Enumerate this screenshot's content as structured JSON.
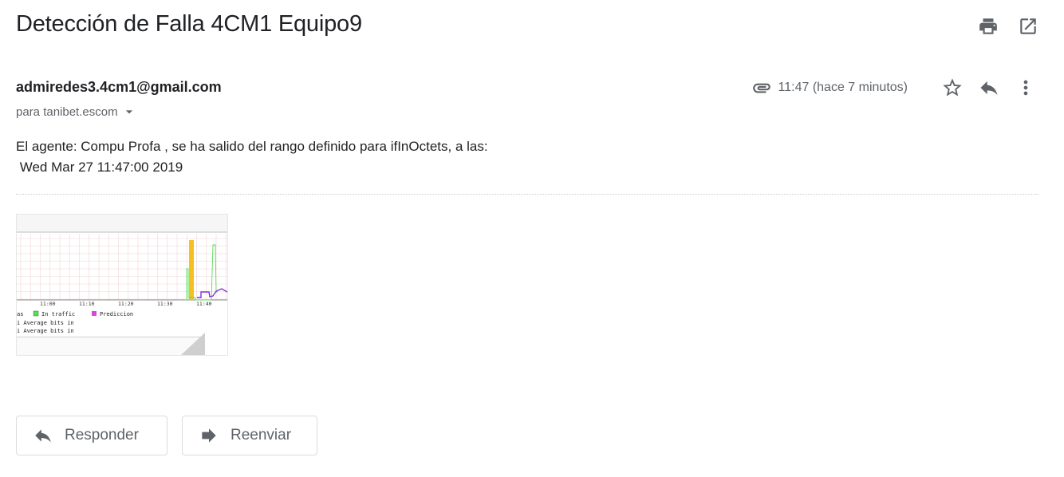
{
  "email": {
    "subject": "Detección de Falla 4CM1 Equipo9",
    "sender": "admiredes3.4cm1@gmail.com",
    "recipient": "para tanibet.escom",
    "time": "11:47 (hace 7 minutos)",
    "body_line1": "El agente: Compu Profa , se ha salido del rango definido para ifInOctets, a las:",
    "body_line2": " Wed Mar 27 11:47:00 2019"
  },
  "attachment": {
    "x_ticks": [
      "11:00",
      "11:10",
      "11:20",
      "11:30",
      "11:40"
    ],
    "legend": {
      "row1_prefix": "as",
      "in_traffic": "In traffic",
      "prediccion": "Prediccion",
      "row2": "i Average bits in",
      "row3": "i Average bits in"
    },
    "colors": {
      "in_traffic": "#55dd55",
      "prediccion": "#dd44dd",
      "fail": "#f4c020",
      "pred_line": "#8a2be2"
    }
  },
  "actions": {
    "reply_label": "Responder",
    "forward_label": "Reenviar"
  },
  "icons": {
    "print": "print-icon",
    "open_new": "open-in-new-icon",
    "attachment": "paperclip-icon",
    "star": "star-icon",
    "reply": "reply-icon",
    "more": "more-vert-icon",
    "dropdown": "caret-down-icon",
    "forward": "forward-icon"
  }
}
